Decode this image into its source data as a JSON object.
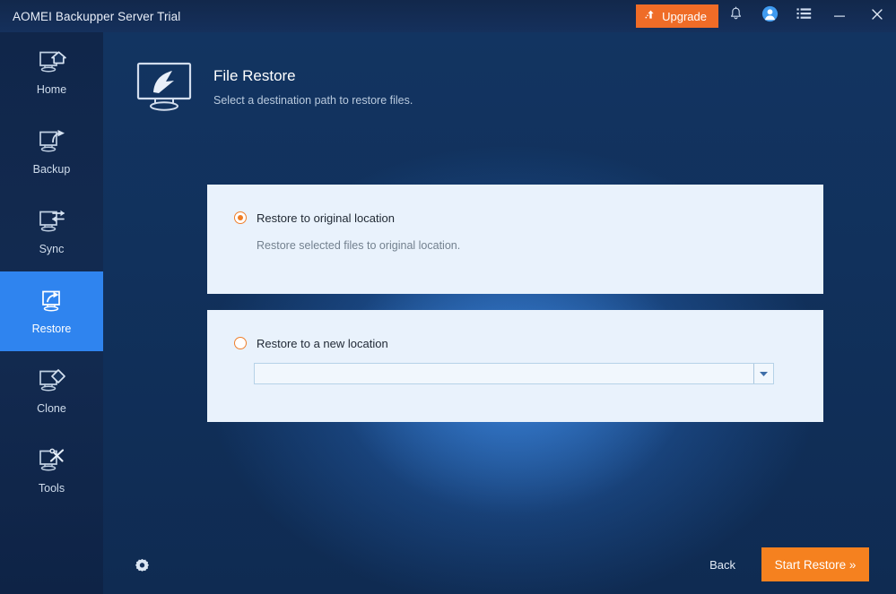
{
  "window": {
    "title": "AOMEI Backupper Server Trial",
    "upgrade_label": "Upgrade",
    "icons": {
      "upgrade": "upgrade-arrow-icon",
      "notification": "bell-icon",
      "account": "user-account-icon",
      "menu": "list-menu-icon",
      "minimize": "minimize-icon",
      "close": "close-icon"
    }
  },
  "sidebar": {
    "items": [
      {
        "label": "Home",
        "icon": "monitor-home-icon",
        "active": false
      },
      {
        "label": "Backup",
        "icon": "monitor-share-icon",
        "active": false
      },
      {
        "label": "Sync",
        "icon": "monitor-sync-icon",
        "active": false
      },
      {
        "label": "Restore",
        "icon": "monitor-restore-icon",
        "active": true
      },
      {
        "label": "Clone",
        "icon": "monitor-clone-icon",
        "active": false
      },
      {
        "label": "Tools",
        "icon": "monitor-tools-icon",
        "active": false
      }
    ]
  },
  "page": {
    "icon": "monitor-restore-large-icon",
    "title": "File Restore",
    "subtitle": "Select a destination path to restore files."
  },
  "options": {
    "original": {
      "label": "Restore to original location",
      "description": "Restore selected files to original location.",
      "selected": true
    },
    "new_location": {
      "label": "Restore to a new location",
      "selected": false,
      "path_value": "",
      "path_placeholder": ""
    }
  },
  "footer": {
    "settings_icon": "gear-icon",
    "back_label": "Back",
    "start_label": "Start Restore »"
  },
  "colors": {
    "accent_orange": "#f5811f",
    "upgrade_orange": "#ef6c27",
    "active_blue": "#2f84ef",
    "card_bg": "#e9f2fc",
    "titlebar_bg": "#15305c"
  }
}
